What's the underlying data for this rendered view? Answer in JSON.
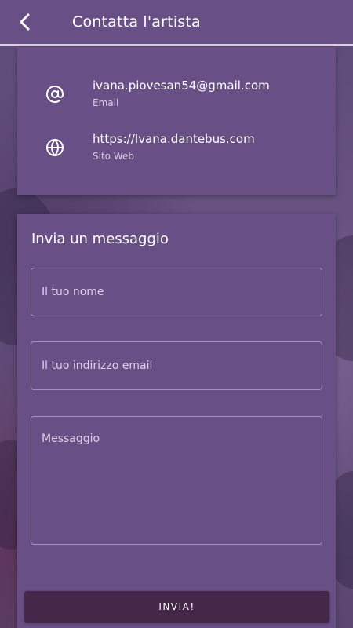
{
  "header": {
    "title": "Contatta l'artista",
    "back_icon": "chevron-left-icon"
  },
  "contacts": [
    {
      "icon": "at-sign-icon",
      "value": "ivana.piovesan54@gmail.com",
      "label": "Email"
    },
    {
      "icon": "globe-icon",
      "value": "https://Ivana.dantebus.com",
      "label": "Sito Web"
    }
  ],
  "form": {
    "title": "Invia un messaggio",
    "name_placeholder": "Il tuo nome",
    "email_placeholder": "Il tuo indirizzo email",
    "message_placeholder": "Messaggio",
    "send_label": "INVIA!"
  },
  "colors": {
    "surface": "#684f85",
    "button": "#45274a",
    "text": "#ffffff"
  }
}
